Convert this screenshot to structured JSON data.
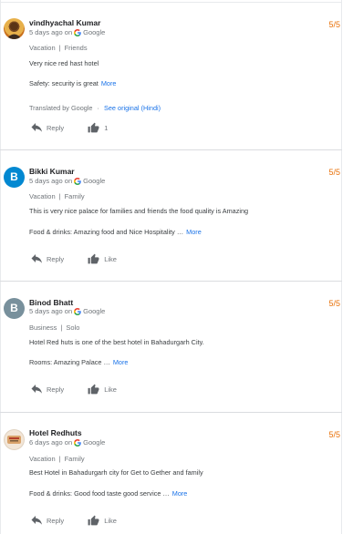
{
  "colors": {
    "accent": "#1a73e8",
    "rating": "#e8710a",
    "muted": "#70757a"
  },
  "reviews": [
    {
      "name": "vindhyachal Kumar",
      "time": "5 days ago on",
      "source": "Google",
      "rating": "5/5",
      "trip_type": "Vacation",
      "companions": "Friends",
      "text": "Very nice red hast hotel",
      "subtext": "Safety: security is great",
      "more": "More",
      "translated_prefix": "Translated by Google",
      "translated_sep": "·",
      "see_original": "See original (Hindi)",
      "reply": "Reply",
      "like": "1",
      "avatar_color": "#c77a1d",
      "avatar_letter": "",
      "avatar_icon": "photo-avatar-icon"
    },
    {
      "name": "Bikki Kumar",
      "time": "5 days ago on",
      "source": "Google",
      "rating": "5/5",
      "trip_type": "Vacation",
      "companions": "Family",
      "text": "This is very nice palace for families and friends the food quality is Amazing",
      "subtext": "Food & drinks: Amazing food and Nice Hospitality …",
      "more": "More",
      "reply": "Reply",
      "like": "Like",
      "avatar_color": "#0288d1",
      "avatar_letter": "B"
    },
    {
      "name": "Binod Bhatt",
      "time": "5 days ago on",
      "source": "Google",
      "rating": "5/5",
      "trip_type": "Business",
      "companions": "Solo",
      "text": "Hotel Red huts is one of the best hotel in Bahadurgarh City.",
      "subtext": "Rooms: Amazing Palace …",
      "more": "More",
      "reply": "Reply",
      "like": "Like",
      "avatar_color": "#78909c",
      "avatar_letter": "B"
    },
    {
      "name": "Hotel Redhuts",
      "time": "6 days ago on",
      "source": "Google",
      "rating": "5/5",
      "trip_type": "Vacation",
      "companions": "Family",
      "text": "Best Hotel in Bahadurgarh city for Get to Gether and family",
      "subtext": "Food & drinks: Good food taste good service …",
      "more": "More",
      "reply": "Reply",
      "like": "Like",
      "avatar_color": "#f2e6d8",
      "avatar_letter": "",
      "avatar_icon": "logo-avatar-icon"
    }
  ]
}
